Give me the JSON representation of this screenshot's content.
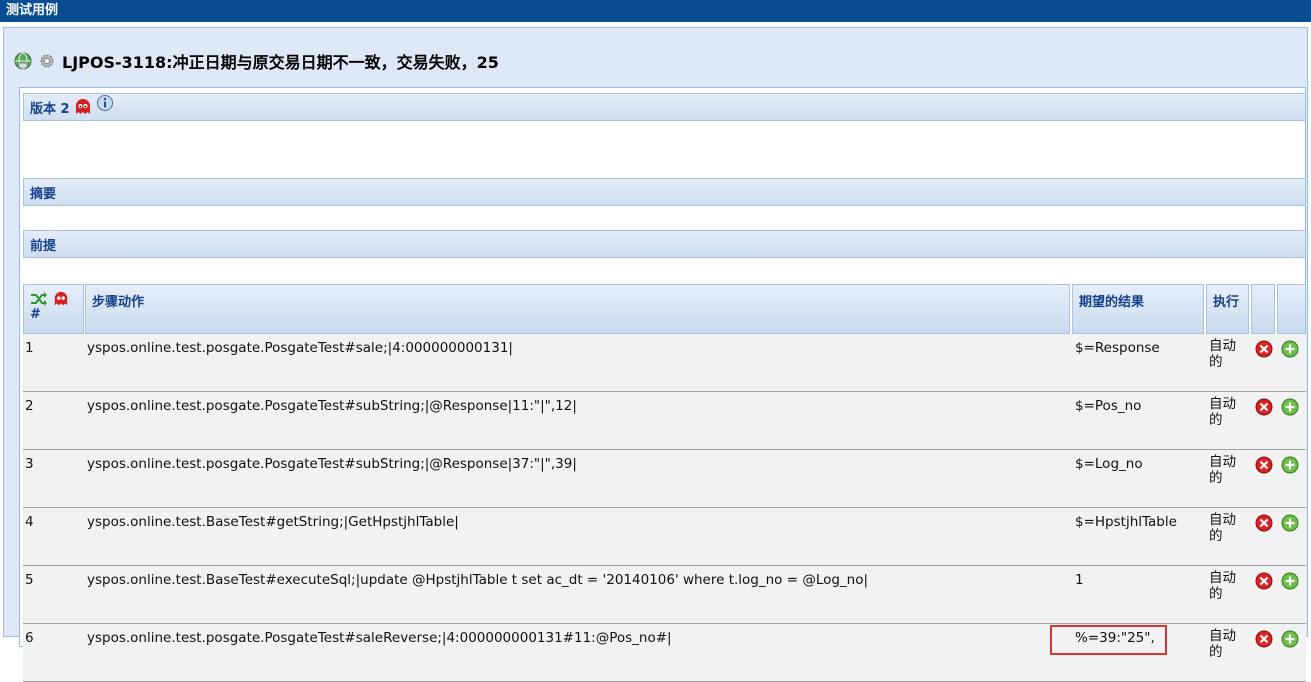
{
  "window": {
    "title": "测试用例"
  },
  "testcase": {
    "title": "LJPOS-3118:冲正日期与原交易日期不一致，交易失败，25"
  },
  "sections": {
    "version_label": "版本 2",
    "summary_label": "摘要",
    "precondition_label": "前提"
  },
  "table": {
    "headers": {
      "num": "#",
      "action": "步骤动作",
      "expected": "期望的结果",
      "exec": "执行"
    },
    "rows": [
      {
        "num": "1",
        "action": "yspos.online.test.posgate.PosgateTest#sale;|4:000000000131|",
        "expected": "$=Response",
        "exec": "自动的"
      },
      {
        "num": "2",
        "action": "yspos.online.test.posgate.PosgateTest#subString;|@Response|11:\"|\",12|",
        "expected": "$=Pos_no",
        "exec": "自动的"
      },
      {
        "num": "3",
        "action": "yspos.online.test.posgate.PosgateTest#subString;|@Response|37:\"|\",39|",
        "expected": "$=Log_no",
        "exec": "自动的"
      },
      {
        "num": "4",
        "action": "yspos.online.test.BaseTest#getString;|GetHpstjhlTable|",
        "expected": "$=HpstjhlTable",
        "exec": "自动的"
      },
      {
        "num": "5",
        "action": "yspos.online.test.BaseTest#executeSql;|update @HpstjhlTable t set ac_dt = '20140106' where t.log_no = @Log_no|",
        "expected": "1",
        "exec": "自动的"
      },
      {
        "num": "6",
        "action": "yspos.online.test.posgate.PosgateTest#saleReverse;|4:000000000131#11:@Pos_no#|",
        "expected": "%=39:\"25\",",
        "exec": "自动的"
      }
    ]
  },
  "icons": {
    "execute": "globe-run-icon",
    "settings": "gear-icon",
    "bug": "red-ghost-icon",
    "info": "info-icon",
    "shuffle": "shuffle-arrows-icon",
    "delete": "delete-icon",
    "add": "add-icon"
  },
  "colors": {
    "titlebar": "#0a4d92",
    "section_text": "#15428b",
    "highlight": "#e0322e"
  }
}
